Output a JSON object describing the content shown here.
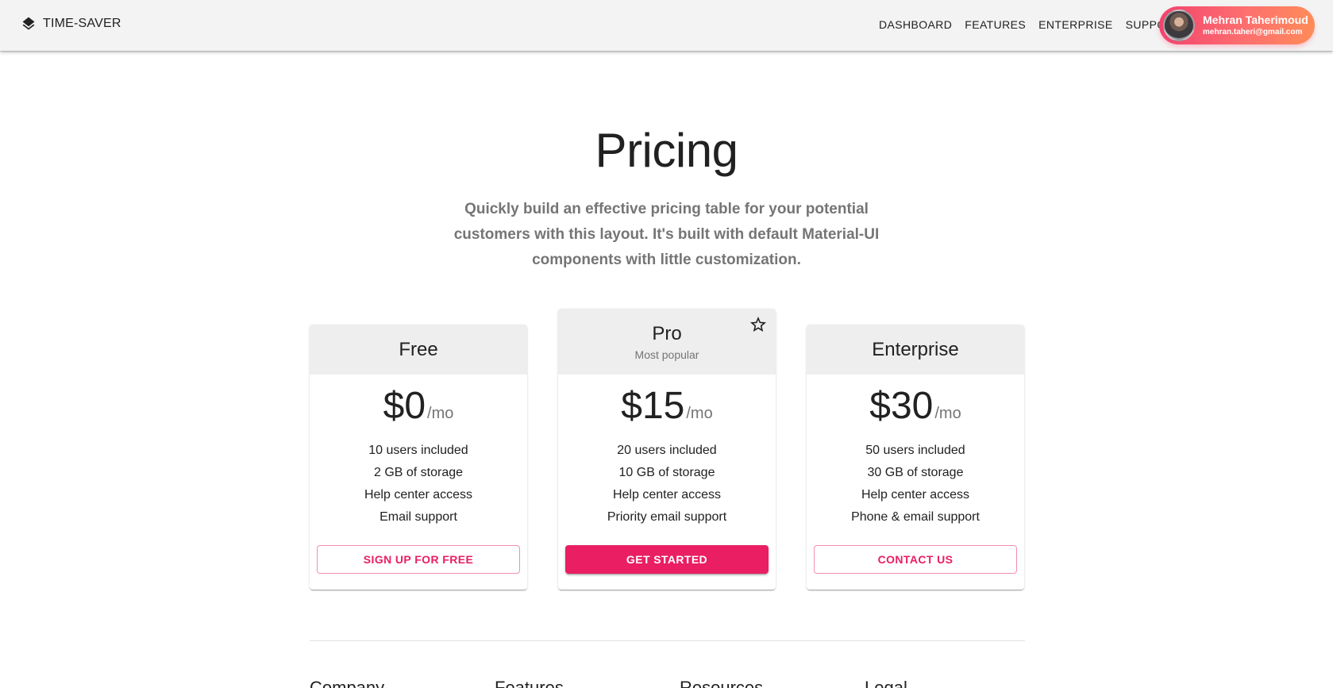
{
  "appbar": {
    "brand": "TIME-SAVER",
    "nav": [
      "DASHBOARD",
      "FEATURES",
      "ENTERPRISE",
      "SUPPORT"
    ],
    "user": {
      "name": "Mehran Taherimoud",
      "email": "mehran.taheri@gmail.com"
    }
  },
  "hero": {
    "title": "Pricing",
    "subtitle": "Quickly build an effective pricing table for your potential customers with this layout. It's built with default Material-UI components with little customization."
  },
  "tiers": [
    {
      "title": "Free",
      "subtitle": "",
      "price": "$0",
      "period": "/mo",
      "features": [
        "10 users included",
        "2 GB of storage",
        "Help center access",
        "Email support"
      ],
      "button": "SIGN UP FOR FREE"
    },
    {
      "title": "Pro",
      "subtitle": "Most popular",
      "price": "$15",
      "period": "/mo",
      "features": [
        "20 users included",
        "10 GB of storage",
        "Help center access",
        "Priority email support"
      ],
      "button": "GET STARTED"
    },
    {
      "title": "Enterprise",
      "subtitle": "",
      "price": "$30",
      "period": "/mo",
      "features": [
        "50 users included",
        "30 GB of storage",
        "Help center access",
        "Phone & email support"
      ],
      "button": "CONTACT US"
    }
  ],
  "footer": {
    "columns": [
      "Company",
      "Features",
      "Resources",
      "Legal"
    ]
  },
  "colors": {
    "accent": "#e91e63",
    "appbar_bg": "#f3f3f3",
    "card_header_bg": "#eeeeee",
    "user_chip_gradient": [
      "#f2436e",
      "#fe8c59"
    ]
  },
  "icons": {
    "brand": "layers-icon",
    "featured": "star-outline-icon"
  }
}
